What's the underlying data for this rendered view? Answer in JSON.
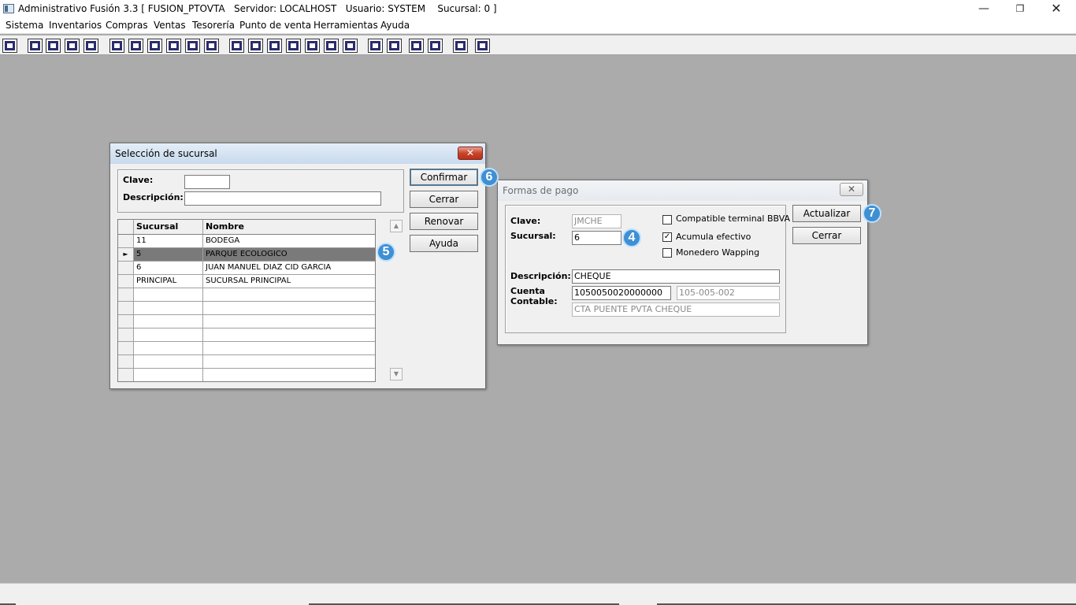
{
  "window": {
    "title": "Administrativo Fusión 3.3 [ FUSION_PTOVTA   Servidor: LOCALHOST   Usuario: SYSTEM    Sucursal: 0 ]",
    "min_glyph": "—",
    "max_glyph": "❐",
    "close_glyph": "✕"
  },
  "menu": [
    "Sistema",
    "Inventarios",
    "Compras",
    "Ventas",
    "Tesorería",
    "Punto de venta",
    "Herramientas",
    "Ayuda"
  ],
  "seleccion_sucursal": {
    "title": "Selección de sucursal",
    "close_glyph": "✕",
    "clave_label": "Clave:",
    "clave_value": "",
    "descripcion_label": "Descripción:",
    "descripcion_value": "",
    "buttons": {
      "confirmar": "Confirmar",
      "cerrar": "Cerrar",
      "renovar": "Renovar",
      "ayuda": "Ayuda"
    },
    "grid": {
      "headers": [
        "Sucursal",
        "Nombre"
      ],
      "rows": [
        {
          "sucursal": "11",
          "nombre": "BODEGA"
        },
        {
          "sucursal": "5",
          "nombre": "PARQUE ECOLOGICO"
        },
        {
          "sucursal": "6",
          "nombre": "JUAN MANUEL DIAZ CID GARCIA"
        },
        {
          "sucursal": "PRINCIPAL",
          "nombre": "SUCURSAL PRINCIPAL"
        }
      ],
      "selected_row": 1,
      "row_indicator": "►"
    },
    "scroll_up": "▲",
    "scroll_down": "▼"
  },
  "formas_pago": {
    "title": "Formas de pago",
    "close_glyph": "✕",
    "clave_label": "Clave:",
    "clave_value": "JMCHE",
    "sucursal_label": "Sucursal:",
    "sucursal_value": "6",
    "checkboxes": [
      {
        "label": "Compatible terminal BBVA",
        "checked": false
      },
      {
        "label": "Acumula efectivo",
        "checked": true
      },
      {
        "label": "Monedero Wapping",
        "checked": false
      }
    ],
    "check_glyph": "✓",
    "descripcion_label": "Descripción:",
    "descripcion_value": "CHEQUE",
    "cuenta_label_1": "Cuenta",
    "cuenta_label_2": "Contable:",
    "cuenta_value": "1050050020000000",
    "cuenta_code": "105-005-002",
    "cuenta_name": "CTA PUENTE PVTA CHEQUE",
    "buttons": {
      "actualizar": "Actualizar",
      "cerrar": "Cerrar"
    }
  },
  "badges": {
    "b4": "4",
    "b5": "5",
    "b6": "6",
    "b7": "7"
  },
  "colors": {
    "badge": "#3f8fd3",
    "desktop": "#ababab",
    "selected_row": "#7a7a7a"
  }
}
